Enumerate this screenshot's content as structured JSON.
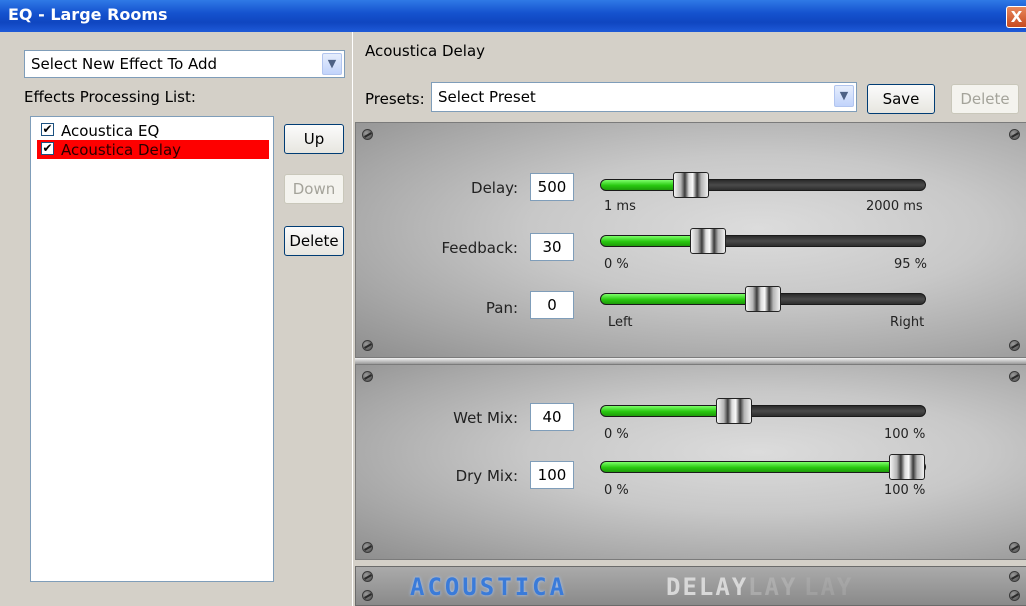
{
  "window": {
    "title": "EQ - Large Rooms",
    "close_glyph": "X"
  },
  "left": {
    "effect_select": "Select New Effect To Add",
    "list_caption": "Effects Processing List:",
    "effects": [
      {
        "label": "Acoustica EQ",
        "checked": true,
        "selected": false
      },
      {
        "label": "Acoustica Delay",
        "checked": true,
        "selected": true
      }
    ],
    "buttons": {
      "up": "Up",
      "down": "Down",
      "delete": "Delete"
    }
  },
  "right": {
    "effect_name": "Acoustica Delay",
    "presets_label": "Presets:",
    "preset_value": "Select Preset",
    "save": "Save",
    "delete": "Delete"
  },
  "params": {
    "delay": {
      "label": "Delay:",
      "value": "500",
      "min": "1 ms",
      "max": "2000 ms",
      "level": 0.25
    },
    "feedback": {
      "label": "Feedback:",
      "value": "30",
      "min": "0 %",
      "max": "95 %",
      "level": 0.31
    },
    "pan": {
      "label": "Pan:",
      "value": "0",
      "min": "Left",
      "max": "Right",
      "level": 0.5
    },
    "wet": {
      "label": "Wet Mix:",
      "value": "40",
      "min": "0 %",
      "max": "100 %",
      "level": 0.4
    },
    "dry": {
      "label": "Dry Mix:",
      "value": "100",
      "min": "0 %",
      "max": "100 %",
      "level": 1.0
    }
  },
  "logo": {
    "brand": "ACOUSTICA",
    "product": "DELAY",
    "echo": [
      "LAY",
      "LAY"
    ]
  },
  "colors": {
    "accent": "#2f79e6",
    "selected_item": "#fe0000",
    "slider_fill": "#28c80f"
  }
}
